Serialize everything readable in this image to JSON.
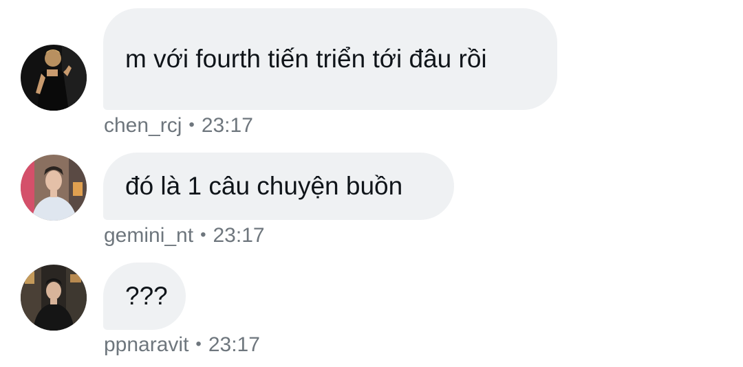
{
  "messages": [
    {
      "username": "chen_rcj",
      "time": "23:17",
      "separator": "•",
      "text": "m với fourth tiến triển tới đâu rồi",
      "avatar_icon": "person-avatar-icon"
    },
    {
      "username": "gemini_nt",
      "time": "23:17",
      "separator": "•",
      "text": "đó là 1 câu chuyện buồn",
      "avatar_icon": "person-avatar-icon"
    },
    {
      "username": "ppnaravit",
      "time": "23:17",
      "separator": "•",
      "text": "???",
      "avatar_icon": "person-avatar-icon"
    }
  ],
  "colors": {
    "bubble_background": "#eff1f3",
    "text": "#0f1419",
    "meta_text": "#6e767d",
    "page_background": "#ffffff"
  }
}
